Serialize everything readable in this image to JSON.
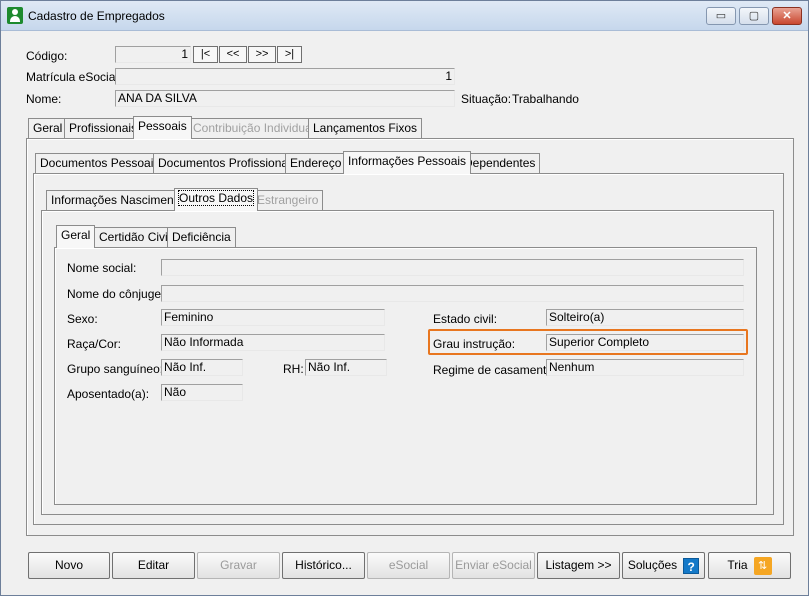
{
  "window": {
    "title": "Cadastro de Empregados",
    "min_label": "▭",
    "max_label": "▢",
    "close_label": "✕"
  },
  "header": {
    "codigo_label": "Código:",
    "codigo_value": "1",
    "nav": [
      "|<",
      "<<",
      ">>",
      ">|"
    ],
    "matricula_label": "Matrícula eSocial:",
    "matricula_value": "1",
    "nome_label": "Nome:",
    "nome_value": "ANA DA SILVA",
    "situacao_label": "Situação:",
    "situacao_value": "Trabalhando"
  },
  "tabs_main": [
    "Geral",
    "Profissionais",
    "Pessoais",
    "Contribuição Individual",
    "Lançamentos Fixos"
  ],
  "tabs_pessoais": [
    "Documentos Pessoais",
    "Documentos Profissionais",
    "Endereço",
    "Informações Pessoais",
    "Dependentes"
  ],
  "tabs_info": [
    "Informações Nascimento",
    "Outros Dados",
    "Estrangeiro"
  ],
  "tabs_outros": [
    "Geral",
    "Certidão Civil",
    "Deficiência"
  ],
  "form": {
    "nome_social_label": "Nome social:",
    "nome_social_value": "",
    "conjuge_label": "Nome do cônjuge:",
    "conjuge_value": "",
    "sexo_label": "Sexo:",
    "sexo_value": "Feminino",
    "raca_label": "Raça/Cor:",
    "raca_value": "Não Informada",
    "grupo_label": "Grupo sanguíneo:",
    "grupo_value": "Não Inf.",
    "rh_label": "RH:",
    "rh_value": "Não Inf.",
    "aposentado_label": "Aposentado(a):",
    "aposentado_value": "Não",
    "estado_civil_label": "Estado civil:",
    "estado_civil_value": "Solteiro(a)",
    "grau_label": "Grau instrução:",
    "grau_value": "Superior Completo",
    "regime_label": "Regime de casamento:",
    "regime_value": "Nenhum"
  },
  "buttons": {
    "novo": "Novo",
    "editar": "Editar",
    "gravar": "Gravar",
    "historico": "Histórico...",
    "esocial": "eSocial",
    "enviar_esocial": "Enviar eSocial",
    "listagem": "Listagem >>",
    "solucoes": "Soluções",
    "help_glyph": "?",
    "tria": "Tria",
    "tria_icon_glyph": "⇅"
  },
  "colors": {
    "highlight": "#e8761f",
    "help": "#1479c8",
    "tria": "#f5a623",
    "app_icon": "#1d8a2e"
  }
}
